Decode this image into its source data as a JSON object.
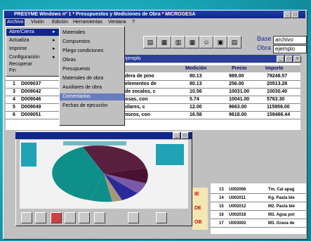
{
  "window": {
    "title": "PRESYME Windows nº 1 * Presupuestos y Mediciones de Obra * MICROGESA"
  },
  "menubar": {
    "items": [
      "Archivo",
      "Visión",
      "Edición",
      "Herramientas",
      "Ventana",
      "?"
    ]
  },
  "toolbar": {
    "base_label": "Base",
    "base_value": "archivo",
    "obra_label": "Obra",
    "obra_value": "ejemplo"
  },
  "file_menu": {
    "items": [
      "Abre/Cierra",
      "Actualiza",
      "Imprime",
      "Configuración",
      "Recuperar",
      "Fin"
    ]
  },
  "submenu": {
    "items": [
      "Materiales",
      "Compuestos",
      "Pliego condiciones",
      "Obras",
      "Presupuesto",
      "Materiales de obra",
      "Auxiliares de obra",
      "Comentarios",
      "Fechas de ejecución"
    ],
    "highlighted": "Comentarios"
  },
  "grid": {
    "title": "ejemplo",
    "columns": [
      "Medición",
      "Precio",
      "Importe"
    ],
    "first_row_text": "dera de pino",
    "rows": [
      {
        "num": "1",
        "code": "D009037",
        "desc": "elementos de",
        "med": "80.13",
        "price": "256.00",
        "total": "20513.28"
      },
      {
        "num": "3",
        "code": "D009042",
        "desc": "de zocalos, c",
        "med": "10.56",
        "price": "10031.00",
        "total": "10030.40"
      },
      {
        "num": "4",
        "code": "D009046",
        "desc": "m3. De hormigón H-175 en losas, con",
        "med": "5.74",
        "price": "10041.00",
        "total": "5763.30"
      },
      {
        "num": "5",
        "code": "D009049",
        "desc": "m3. De hormigón H-175 en pilares, c",
        "med": "12.00",
        "price": "9663.00",
        "total": "115956.00"
      },
      {
        "num": "6",
        "code": "D009051",
        "desc": "m3. De hormigón H-175 en muros, con",
        "med": "16.58",
        "price": "9618.00",
        "total": "159466.44"
      }
    ],
    "top_row": {
      "med": "80.13",
      "price": "989.00",
      "total": "79248.57"
    }
  },
  "right_table": {
    "rows": [
      {
        "num": "13",
        "code": "U002006",
        "desc": "Tm. Cal apag"
      },
      {
        "num": "14",
        "code": "U002011",
        "desc": "Kg. Pasta ble"
      },
      {
        "num": "15",
        "code": "U002012",
        "desc": "M2. Pasta ble"
      },
      {
        "num": "16",
        "code": "U002018",
        "desc": "M3. Agua pot"
      },
      {
        "num": "17",
        "code": "U003002",
        "desc": "M3. Grava de"
      }
    ],
    "side_label_1": "IE",
    "side_label_2": "DE",
    "side_label_3": "OB"
  },
  "colors": {
    "titlebar": "#10268a",
    "desktop": "#1aa0b0",
    "pie_maroon": "#5a1f3f",
    "pie_teal": "#0f8f8a",
    "pie_blue": "#2a2a9a",
    "pie_purple": "#7a5aa8",
    "pie_tan": "#a89878"
  }
}
